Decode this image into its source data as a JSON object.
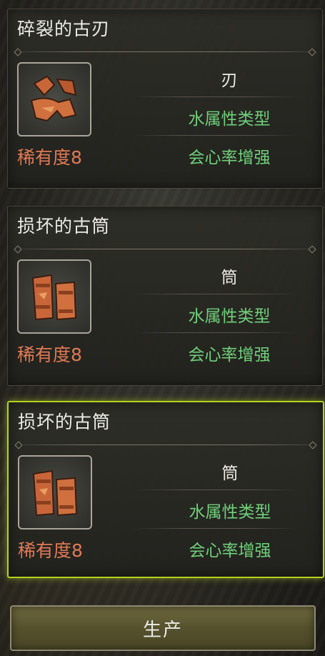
{
  "materials": [
    {
      "name": "碎裂的古刃",
      "rarity": "稀有度8",
      "type": "刃",
      "element": "水属性类型",
      "skill": "会心率增强",
      "icon": "broken-blade-icon",
      "selected": false
    },
    {
      "name": "损坏的古筒",
      "rarity": "稀有度8",
      "type": "筒",
      "element": "水属性类型",
      "skill": "会心率增强",
      "icon": "broken-barrel-icon",
      "selected": false
    },
    {
      "name": "损坏的古筒",
      "rarity": "稀有度8",
      "type": "筒",
      "element": "水属性类型",
      "skill": "会心率增强",
      "icon": "broken-barrel-icon",
      "selected": true
    }
  ],
  "produce_button": {
    "label": "生产"
  },
  "colors": {
    "rarity": "#e07a55",
    "attribute_green": "#6fd07a",
    "selection_highlight": "#b5d21e"
  }
}
